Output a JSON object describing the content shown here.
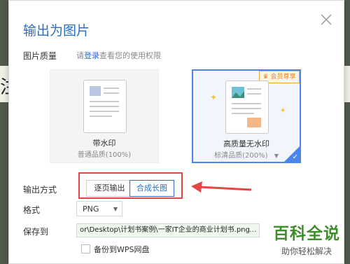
{
  "background": {
    "left_char": "注",
    "right_char": "]"
  },
  "dialog": {
    "title": "输出为图片",
    "close_label": "×",
    "quality": {
      "label": "图片质量",
      "hint_prefix": "请",
      "hint_link": "登录",
      "hint_suffix": "查看您的使用权限"
    },
    "cards": [
      {
        "title": "带水印",
        "sub": "普通品质(100%)"
      },
      {
        "title": "高质量无水印",
        "sub": "标清品质(200%)",
        "badge": "会员尊享",
        "selected": true
      }
    ],
    "output_mode": {
      "label": "输出方式",
      "options": [
        "逐页输出",
        "合成长图"
      ],
      "selected": "合成长图"
    },
    "format": {
      "label": "格式",
      "value": "PNG"
    },
    "save_to": {
      "label": "保存到",
      "path": "or\\Desktop\\计划书案例\\一家IT企业的商业计划书.png",
      "browse": "..."
    },
    "backup": {
      "label": "备份到WPS网盘",
      "checked": false
    }
  },
  "watermark": {
    "big": "百科全说",
    "small": "助你轻松解决"
  },
  "colors": {
    "accent": "#2b6fc4",
    "highlight": "#e24747",
    "watermark": "#3e8e2d"
  }
}
